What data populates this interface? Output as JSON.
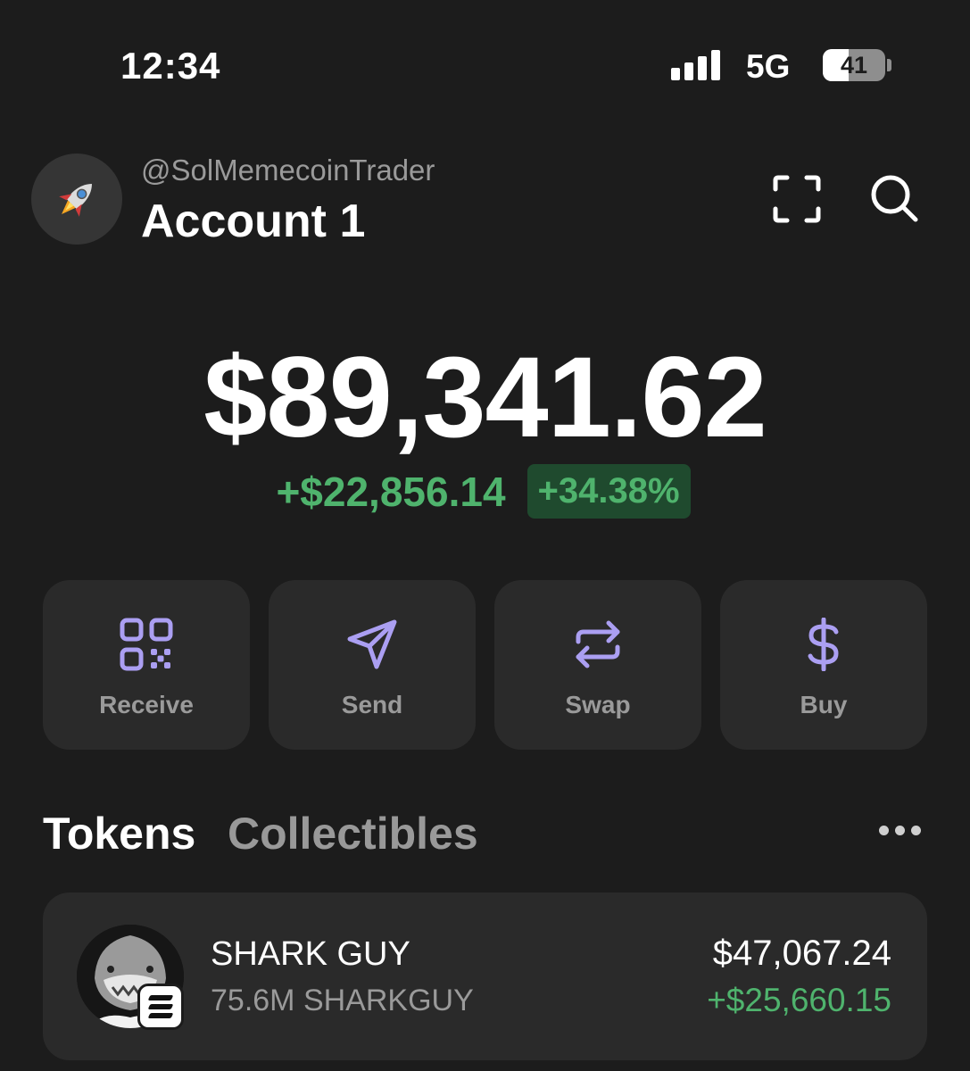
{
  "status_bar": {
    "time": "12:34",
    "network": "5G",
    "battery": "41",
    "battery_level": 0.41
  },
  "header": {
    "handle": "@SolMemecoinTrader",
    "account_name": "Account 1",
    "avatar_emoji": "🚀",
    "icons": [
      "scan-icon",
      "search-icon"
    ]
  },
  "balance": {
    "total": "$89,341.62",
    "change_amount": "+$22,856.14",
    "change_percent": "+34.38%"
  },
  "actions": [
    {
      "label": "Receive",
      "icon": "qr-code-icon"
    },
    {
      "label": "Send",
      "icon": "send-icon"
    },
    {
      "label": "Swap",
      "icon": "swap-icon"
    },
    {
      "label": "Buy",
      "icon": "dollar-icon"
    }
  ],
  "tabs": {
    "tokens": "Tokens",
    "collectibles": "Collectibles"
  },
  "tokens": [
    {
      "name": "SHARK GUY",
      "amount": "75.6M SHARKGUY",
      "value": "$47,067.24",
      "change": "+$25,660.15"
    }
  ],
  "colors": {
    "background": "#1c1c1c",
    "card": "#2a2a2a",
    "accent": "#ab9ff2",
    "positive": "#4fb36d"
  }
}
